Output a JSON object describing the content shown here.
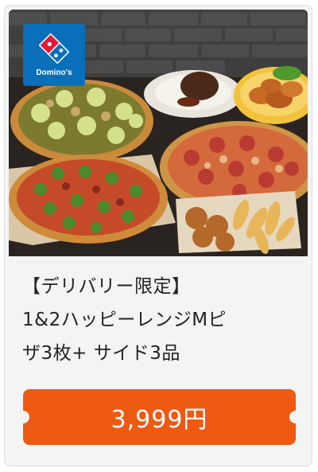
{
  "brand": {
    "logo_text": "Domino's",
    "logo_color": "#0a6fba"
  },
  "product": {
    "title_line1": "【デリバリー限定】",
    "title_line2": "1&2ハッピーレンジMピ",
    "title_line3": "ザ3枚+ サイド3品"
  },
  "price": {
    "label": "3,999円",
    "button_color": "#ee5a12"
  }
}
